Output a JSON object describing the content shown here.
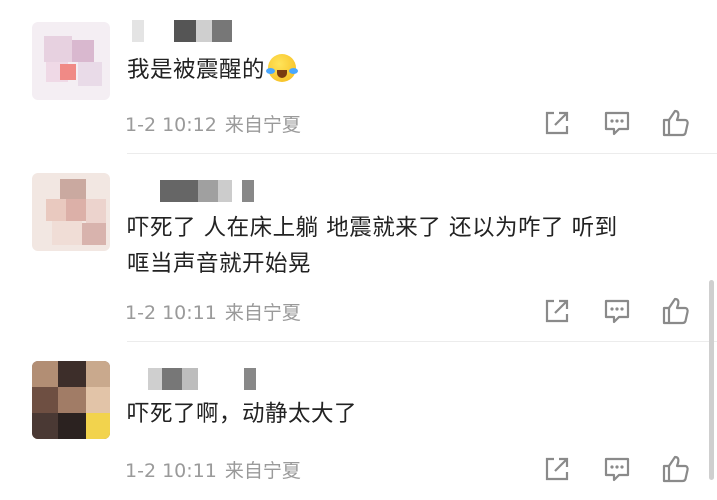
{
  "comments": [
    {
      "text": "我是被震醒的",
      "emoji": "crying-laughing-emoji",
      "time": "1-2 10:12",
      "location": "来自宁夏"
    },
    {
      "line1": "吓死了 人在床上躺 地震就来了 还以为咋了 听到",
      "line2": "哐当声音就开始晃",
      "time": "1-2 10:11",
      "location": "来自宁夏"
    },
    {
      "text": "吓死了啊，动静太大了",
      "time": "1-2 10:11",
      "location": "来自宁夏"
    }
  ],
  "actions": {
    "icons": [
      "share-icon",
      "comment-icon",
      "like-icon"
    ]
  },
  "colors": {
    "text": "#222222",
    "meta": "#9a9a9a",
    "icon": "#8a8a8a",
    "divider": "#ececec"
  }
}
